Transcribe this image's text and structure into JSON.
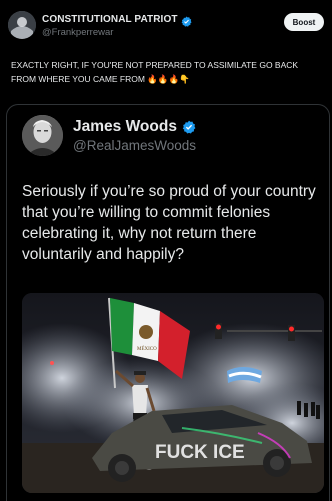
{
  "post": {
    "author_name": "CONSTITUTIONAL PATRIOT",
    "author_handle": "@Frankperrewar",
    "boost_label": "Boost",
    "text": "EXACTLY RIGHT, IF YOU'RE NOT PREPARED TO ASSIMILATE GO BACK FROM WHERE YOU CAME FROM 🔥🔥🔥👇"
  },
  "quoted": {
    "author_name": "James Woods",
    "author_handle": "@RealJamesWoods",
    "text": "Seriously if you’re so proud of your country that you’re willing to commit felonies celebrating it, why not return there voluntarily and happily?",
    "media_graffiti": "FUCK ICE"
  },
  "colors": {
    "verified": "#1d9bf0",
    "background": "#000000"
  },
  "icons": {
    "verified": "verified-badge-icon"
  }
}
